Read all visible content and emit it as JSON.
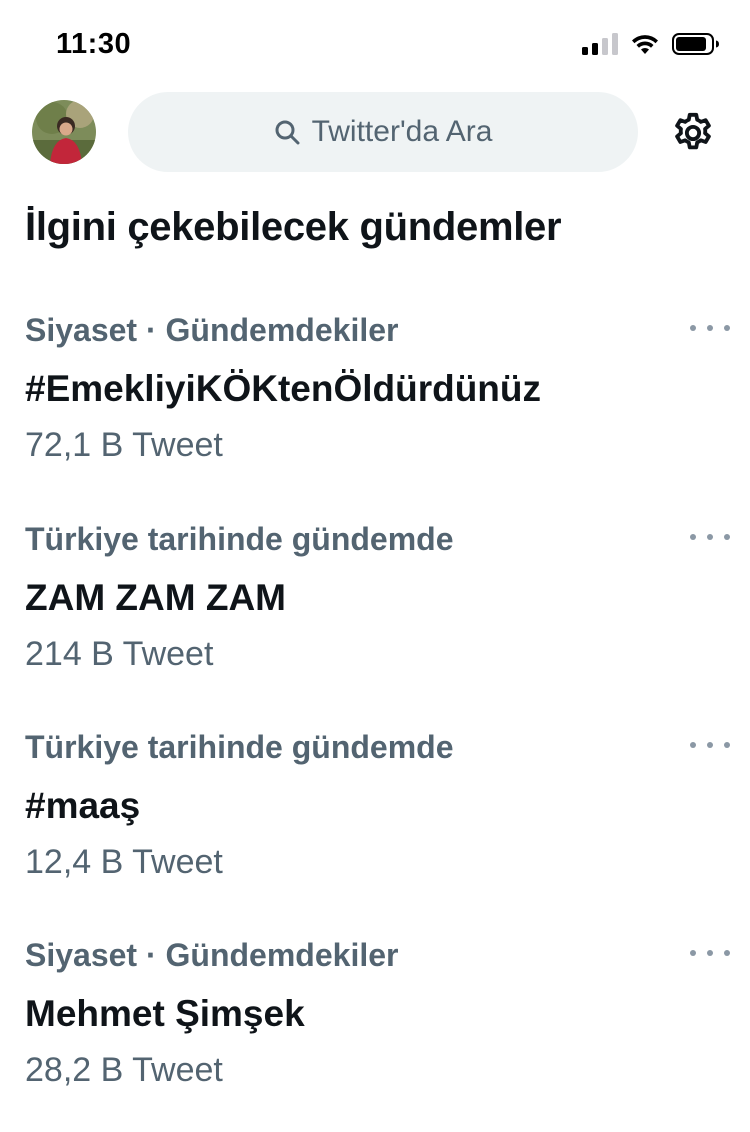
{
  "status": {
    "time": "11:30",
    "icons": [
      "signal-icon",
      "wifi-icon",
      "battery-icon"
    ]
  },
  "header": {
    "search_placeholder": "Twitter'da Ara",
    "icons": [
      "avatar",
      "search-icon",
      "settings-icon"
    ]
  },
  "section": {
    "title": "İlgini çekebilecek gündemler"
  },
  "trends": [
    {
      "meta": "Siyaset · Gündemdekiler",
      "name": "#EmekliyiKÖKtenÖldürdünüz",
      "count": "72,1 B Tweet"
    },
    {
      "meta": "Türkiye tarihinde gündemde",
      "name": "ZAM ZAM ZAM",
      "count": "214 B Tweet"
    },
    {
      "meta": "Türkiye tarihinde gündemde",
      "name": "#maaş",
      "count": "12,4 B Tweet"
    },
    {
      "meta": "Siyaset · Gündemdekiler",
      "name": "Mehmet Şimşek",
      "count": "28,2 B Tweet"
    }
  ],
  "colors": {
    "text_primary": "#0f1419",
    "text_secondary": "#536471",
    "search_bg": "#eff3f4"
  }
}
